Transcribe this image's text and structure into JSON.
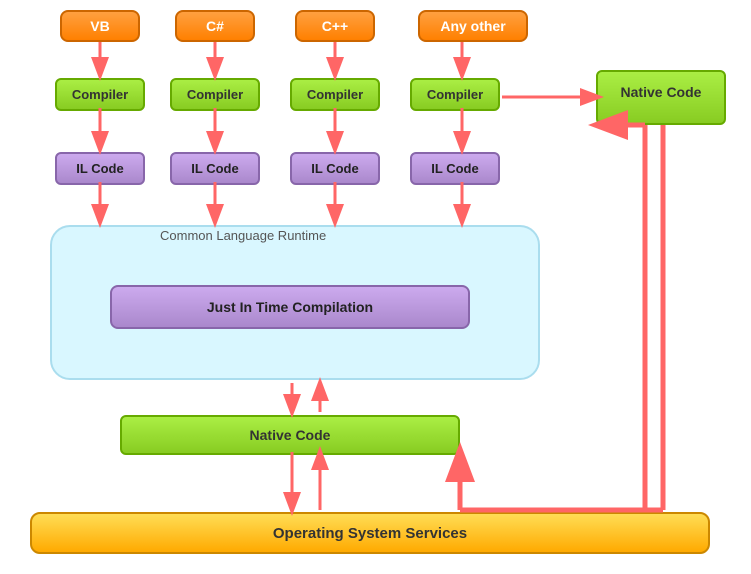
{
  "languages": [
    {
      "label": "VB",
      "id": "vb"
    },
    {
      "label": "C#",
      "id": "cs"
    },
    {
      "label": "C++",
      "id": "cpp"
    },
    {
      "label": "Any other",
      "id": "other"
    }
  ],
  "compilers": [
    {
      "label": "Compiler"
    },
    {
      "label": "Compiler"
    },
    {
      "label": "Compiler"
    },
    {
      "label": "Compiler"
    }
  ],
  "ilcodes": [
    {
      "label": "IL Code"
    },
    {
      "label": "IL Code"
    },
    {
      "label": "IL Code"
    },
    {
      "label": "IL Code"
    }
  ],
  "clr_label": "Common Language Runtime",
  "jit_label": "Just In Time Compilation",
  "native_right_label": "Native Code",
  "native_bottom_label": "Native Code",
  "os_label": "Operating System Services"
}
